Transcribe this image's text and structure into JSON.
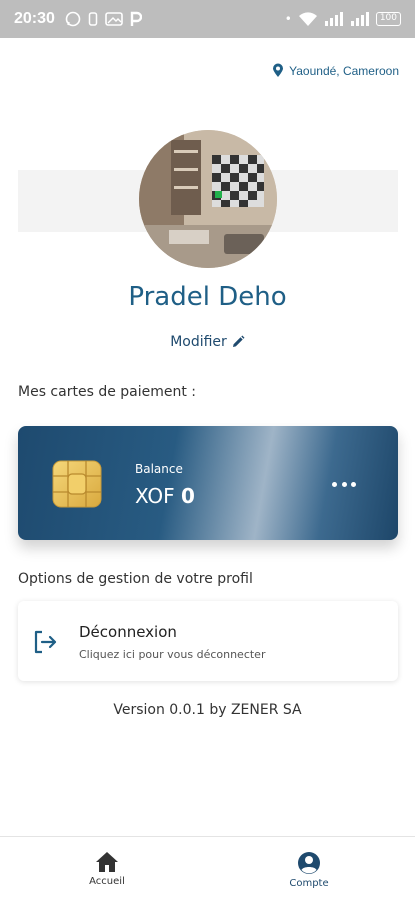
{
  "status_bar": {
    "time": "20:30",
    "battery": "100"
  },
  "location": {
    "text": "Yaoundé, Cameroon"
  },
  "profile": {
    "name": "Pradel Deho",
    "edit_label": "Modifier"
  },
  "payment_cards": {
    "section_label": "Mes cartes de paiement :",
    "card": {
      "caption": "Balance",
      "currency": "XOF",
      "amount": "0"
    }
  },
  "profile_options": {
    "section_label": "Options de gestion de votre profil",
    "logout": {
      "title": "Déconnexion",
      "subtitle": "Cliquez ici pour vous déconnecter"
    }
  },
  "footer": {
    "version": "Version 0.0.1 by ZENER SA"
  },
  "bottom_nav": {
    "items": [
      {
        "label": "Accueil",
        "icon": "home-icon",
        "active": false
      },
      {
        "label": "Compte",
        "icon": "account-icon",
        "active": true
      }
    ]
  },
  "colors": {
    "primary": "#1f5f86",
    "status_bar": "#bdbdbd"
  }
}
